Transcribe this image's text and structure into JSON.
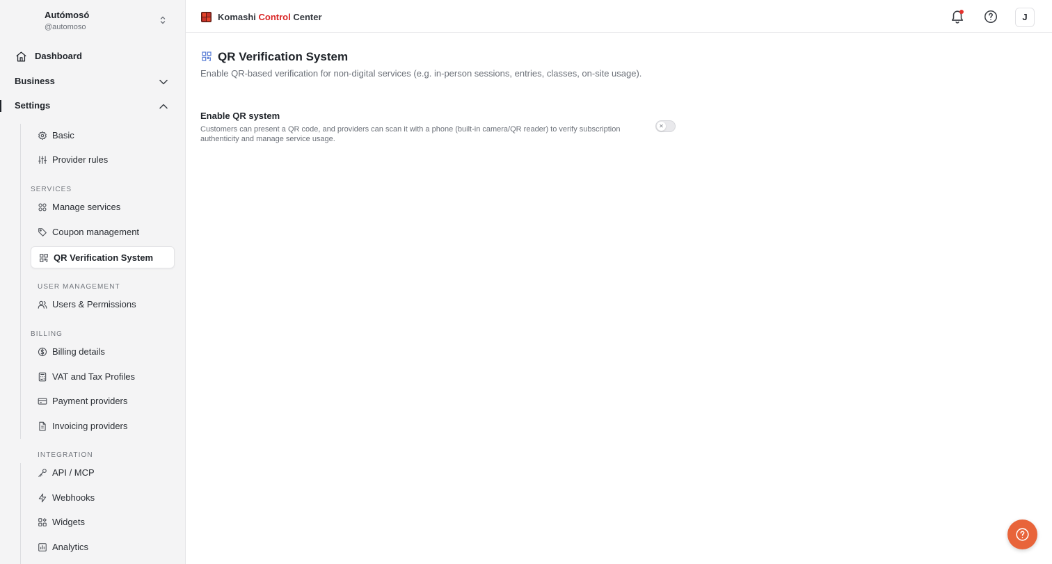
{
  "account": {
    "name": "Autómosó",
    "handle": "@automoso"
  },
  "nav": {
    "dashboard": "Dashboard",
    "business": "Business",
    "settings": "Settings"
  },
  "settings_menu": {
    "basic": "Basic",
    "provider_rules": "Provider rules",
    "services_section": "SERVICES",
    "manage_services": "Manage services",
    "coupon_management": "Coupon management",
    "qr_verification": "QR Verification System",
    "user_management_section": "USER MANAGEMENT",
    "users_permissions": "Users & Permissions",
    "billing_section": "BILLING",
    "billing_details": "Billing details",
    "vat_tax": "VAT and Tax Profiles",
    "payment_providers": "Payment providers",
    "invoicing_providers": "Invoicing providers",
    "integration_section": "INTEGRATION",
    "api_mcp": "API / MCP",
    "webhooks": "Webhooks",
    "widgets": "Widgets",
    "analytics": "Analytics"
  },
  "header": {
    "brand_part1": "Komashi ",
    "brand_part2": "Control",
    "brand_part3": " Center",
    "brand_accent_color": "#d92626",
    "has_notification": true,
    "avatar_initial": "J"
  },
  "page": {
    "title": "QR Verification System",
    "subtitle": "Enable QR-based verification for non-digital services (e.g. in-person sessions, entries, classes, on-site usage).",
    "setting": {
      "title": "Enable QR system",
      "description": "Customers can present a QR code, and providers can scan it with a phone (built-in camera/QR reader) to verify subscription authenticity and manage service usage.",
      "enabled": false
    }
  },
  "icons": {
    "dashboard": "home-icon",
    "business": "chevron-down-icon",
    "settings": "chevron-up-icon",
    "basic": "gear-icon",
    "provider_rules": "sliders-icon",
    "manage_services": "grid-icon",
    "coupon": "tag-icon",
    "qr": "qr-code-icon",
    "users": "users-icon",
    "billing": "dollar-circle-icon",
    "vat": "calculator-icon",
    "payment": "credit-card-icon",
    "invoicing": "document-icon",
    "api": "key-icon",
    "webhooks": "bolt-icon",
    "widgets": "widgets-icon",
    "analytics": "chart-icon",
    "fab": "lifebuoy-icon"
  }
}
